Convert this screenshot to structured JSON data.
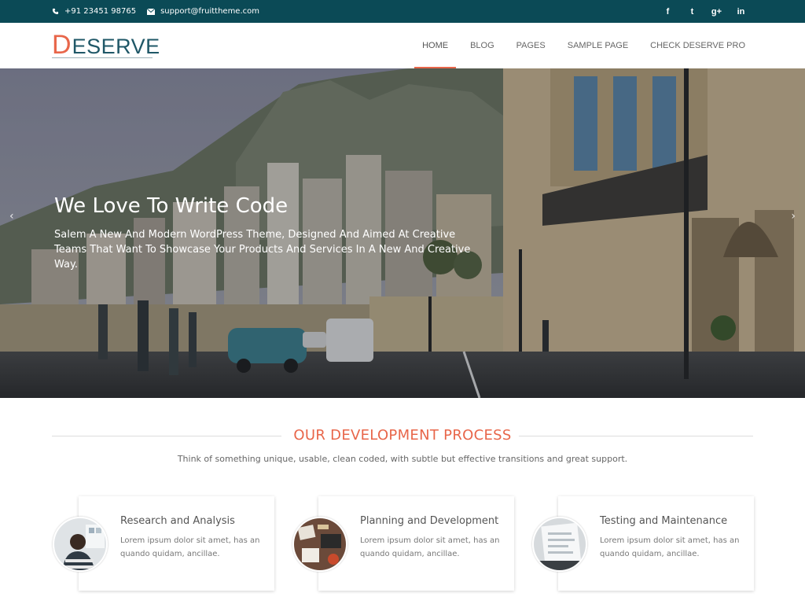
{
  "topbar": {
    "phone": "+91 23451 98765",
    "email": "support@fruittheme.com",
    "social": [
      "f",
      "t",
      "g+",
      "in"
    ]
  },
  "header": {
    "logo_first": "D",
    "logo_rest": "ESERVE",
    "nav": [
      "HOME",
      "BLOG",
      "PAGES",
      "SAMPLE PAGE",
      "CHECK DESERVE PRO"
    ]
  },
  "hero": {
    "title": "We Love To Write Code",
    "text": "Salem A New And Modern WordPress Theme, Designed And Aimed At Creative Teams That Want To Showcase Your Products And Services In A New And Creative Way.",
    "prev_arrow": "‹",
    "next_arrow": "›"
  },
  "process": {
    "title": "OUR DEVELOPMENT PROCESS",
    "subtitle": "Think of something unique, usable, clean coded, with subtle but effective transitions and great support.",
    "cards": [
      {
        "title": "Research and Analysis",
        "text": "Lorem ipsum dolor sit amet, has an quando quidam, ancillae."
      },
      {
        "title": "Planning and Development",
        "text": "Lorem ipsum dolor sit amet, has an quando quidam, ancillae."
      },
      {
        "title": "Testing and Maintenance",
        "text": "Lorem ipsum dolor sit amet, has an quando quidam, ancillae."
      }
    ]
  },
  "colors": {
    "topbar": "#0b4a56",
    "accent": "#e8664a",
    "logo": "#1f5767"
  }
}
